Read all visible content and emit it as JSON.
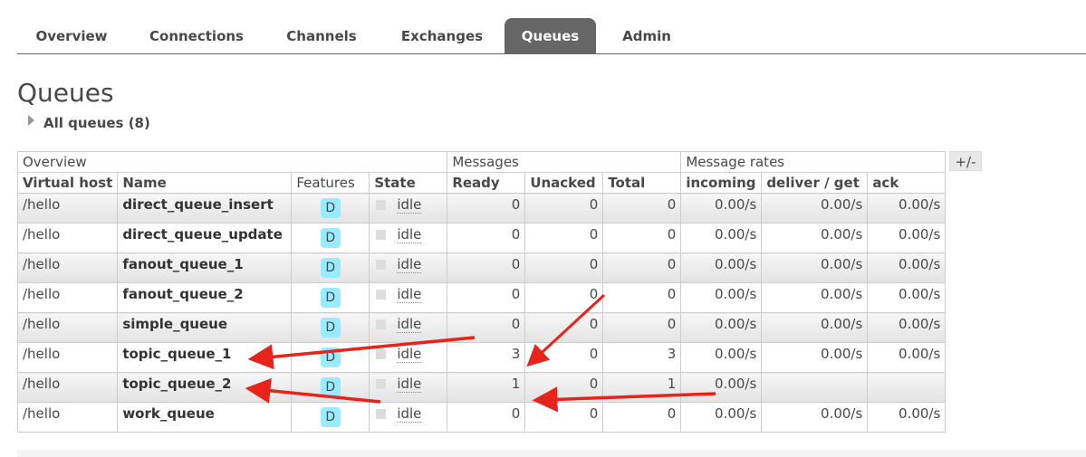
{
  "tabs": [
    {
      "label": "Overview",
      "active": false
    },
    {
      "label": "Connections",
      "active": false
    },
    {
      "label": "Channels",
      "active": false
    },
    {
      "label": "Exchanges",
      "active": false
    },
    {
      "label": "Queues",
      "active": true
    },
    {
      "label": "Admin",
      "active": false
    }
  ],
  "page_title": "Queues",
  "section_toggle": "All queues (8)",
  "table": {
    "group_headers": [
      "Overview",
      "Messages",
      "Message rates"
    ],
    "columns": [
      "Virtual host",
      "Name",
      "Features",
      "State",
      "Ready",
      "Unacked",
      "Total",
      "incoming",
      "deliver / get",
      "ack"
    ],
    "rows": [
      {
        "vhost": "/hello",
        "name": "direct_queue_insert",
        "feature": "D",
        "state": "idle",
        "ready": "0",
        "unacked": "0",
        "total": "0",
        "incoming": "0.00/s",
        "deliver": "0.00/s",
        "ack": "0.00/s"
      },
      {
        "vhost": "/hello",
        "name": "direct_queue_update",
        "feature": "D",
        "state": "idle",
        "ready": "0",
        "unacked": "0",
        "total": "0",
        "incoming": "0.00/s",
        "deliver": "0.00/s",
        "ack": "0.00/s"
      },
      {
        "vhost": "/hello",
        "name": "fanout_queue_1",
        "feature": "D",
        "state": "idle",
        "ready": "0",
        "unacked": "0",
        "total": "0",
        "incoming": "0.00/s",
        "deliver": "0.00/s",
        "ack": "0.00/s"
      },
      {
        "vhost": "/hello",
        "name": "fanout_queue_2",
        "feature": "D",
        "state": "idle",
        "ready": "0",
        "unacked": "0",
        "total": "0",
        "incoming": "0.00/s",
        "deliver": "0.00/s",
        "ack": "0.00/s"
      },
      {
        "vhost": "/hello",
        "name": "simple_queue",
        "feature": "D",
        "state": "idle",
        "ready": "0",
        "unacked": "0",
        "total": "0",
        "incoming": "0.00/s",
        "deliver": "0.00/s",
        "ack": "0.00/s"
      },
      {
        "vhost": "/hello",
        "name": "topic_queue_1",
        "feature": "D",
        "state": "idle",
        "ready": "3",
        "unacked": "0",
        "total": "3",
        "incoming": "0.00/s",
        "deliver": "0.00/s",
        "ack": "0.00/s"
      },
      {
        "vhost": "/hello",
        "name": "topic_queue_2",
        "feature": "D",
        "state": "idle",
        "ready": "1",
        "unacked": "0",
        "total": "1",
        "incoming": "0.00/s",
        "deliver": "",
        "ack": ""
      },
      {
        "vhost": "/hello",
        "name": "work_queue",
        "feature": "D",
        "state": "idle",
        "ready": "0",
        "unacked": "0",
        "total": "0",
        "incoming": "0.00/s",
        "deliver": "0.00/s",
        "ack": "0.00/s"
      }
    ]
  },
  "column_toggle": "+/-",
  "colors": {
    "active_tab": "#666666",
    "feature_badge": "#99ebff",
    "arrow": "#e8231b"
  }
}
